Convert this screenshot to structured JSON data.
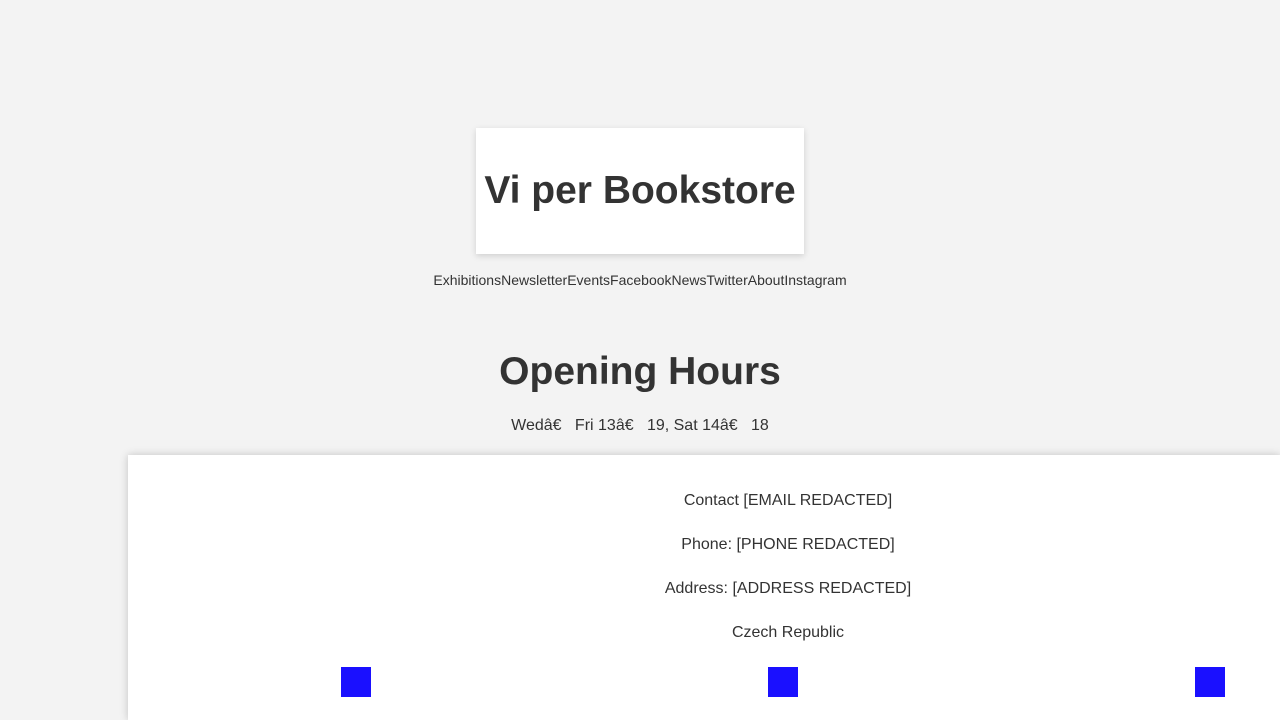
{
  "header": {
    "title": "Vi per Bookstore"
  },
  "nav": {
    "items": [
      {
        "label": "Exhibitions"
      },
      {
        "label": "Newsletter"
      },
      {
        "label": "Events"
      },
      {
        "label": "Facebook"
      },
      {
        "label": "News"
      },
      {
        "label": "Twitter"
      },
      {
        "label": "About"
      },
      {
        "label": "Instagram"
      }
    ]
  },
  "hours": {
    "title": "Opening Hours",
    "text": "Wedâ€   Fri 13â€   19, Sat 14â€   18"
  },
  "footer": {
    "contact": "Contact [EMAIL REDACTED]",
    "phone": "Phone: [PHONE REDACTED]",
    "address": "Address: [ADDRESS REDACTED]",
    "country": "Czech Republic",
    "social_icons": [
      {
        "icon": "social-icon"
      },
      {
        "icon": "social-icon"
      },
      {
        "icon": "social-icon"
      }
    ],
    "icon_color": "#1a10ff"
  },
  "colors": {
    "background": "#f3f3f3",
    "text": "#333333",
    "panel": "#ffffff"
  }
}
